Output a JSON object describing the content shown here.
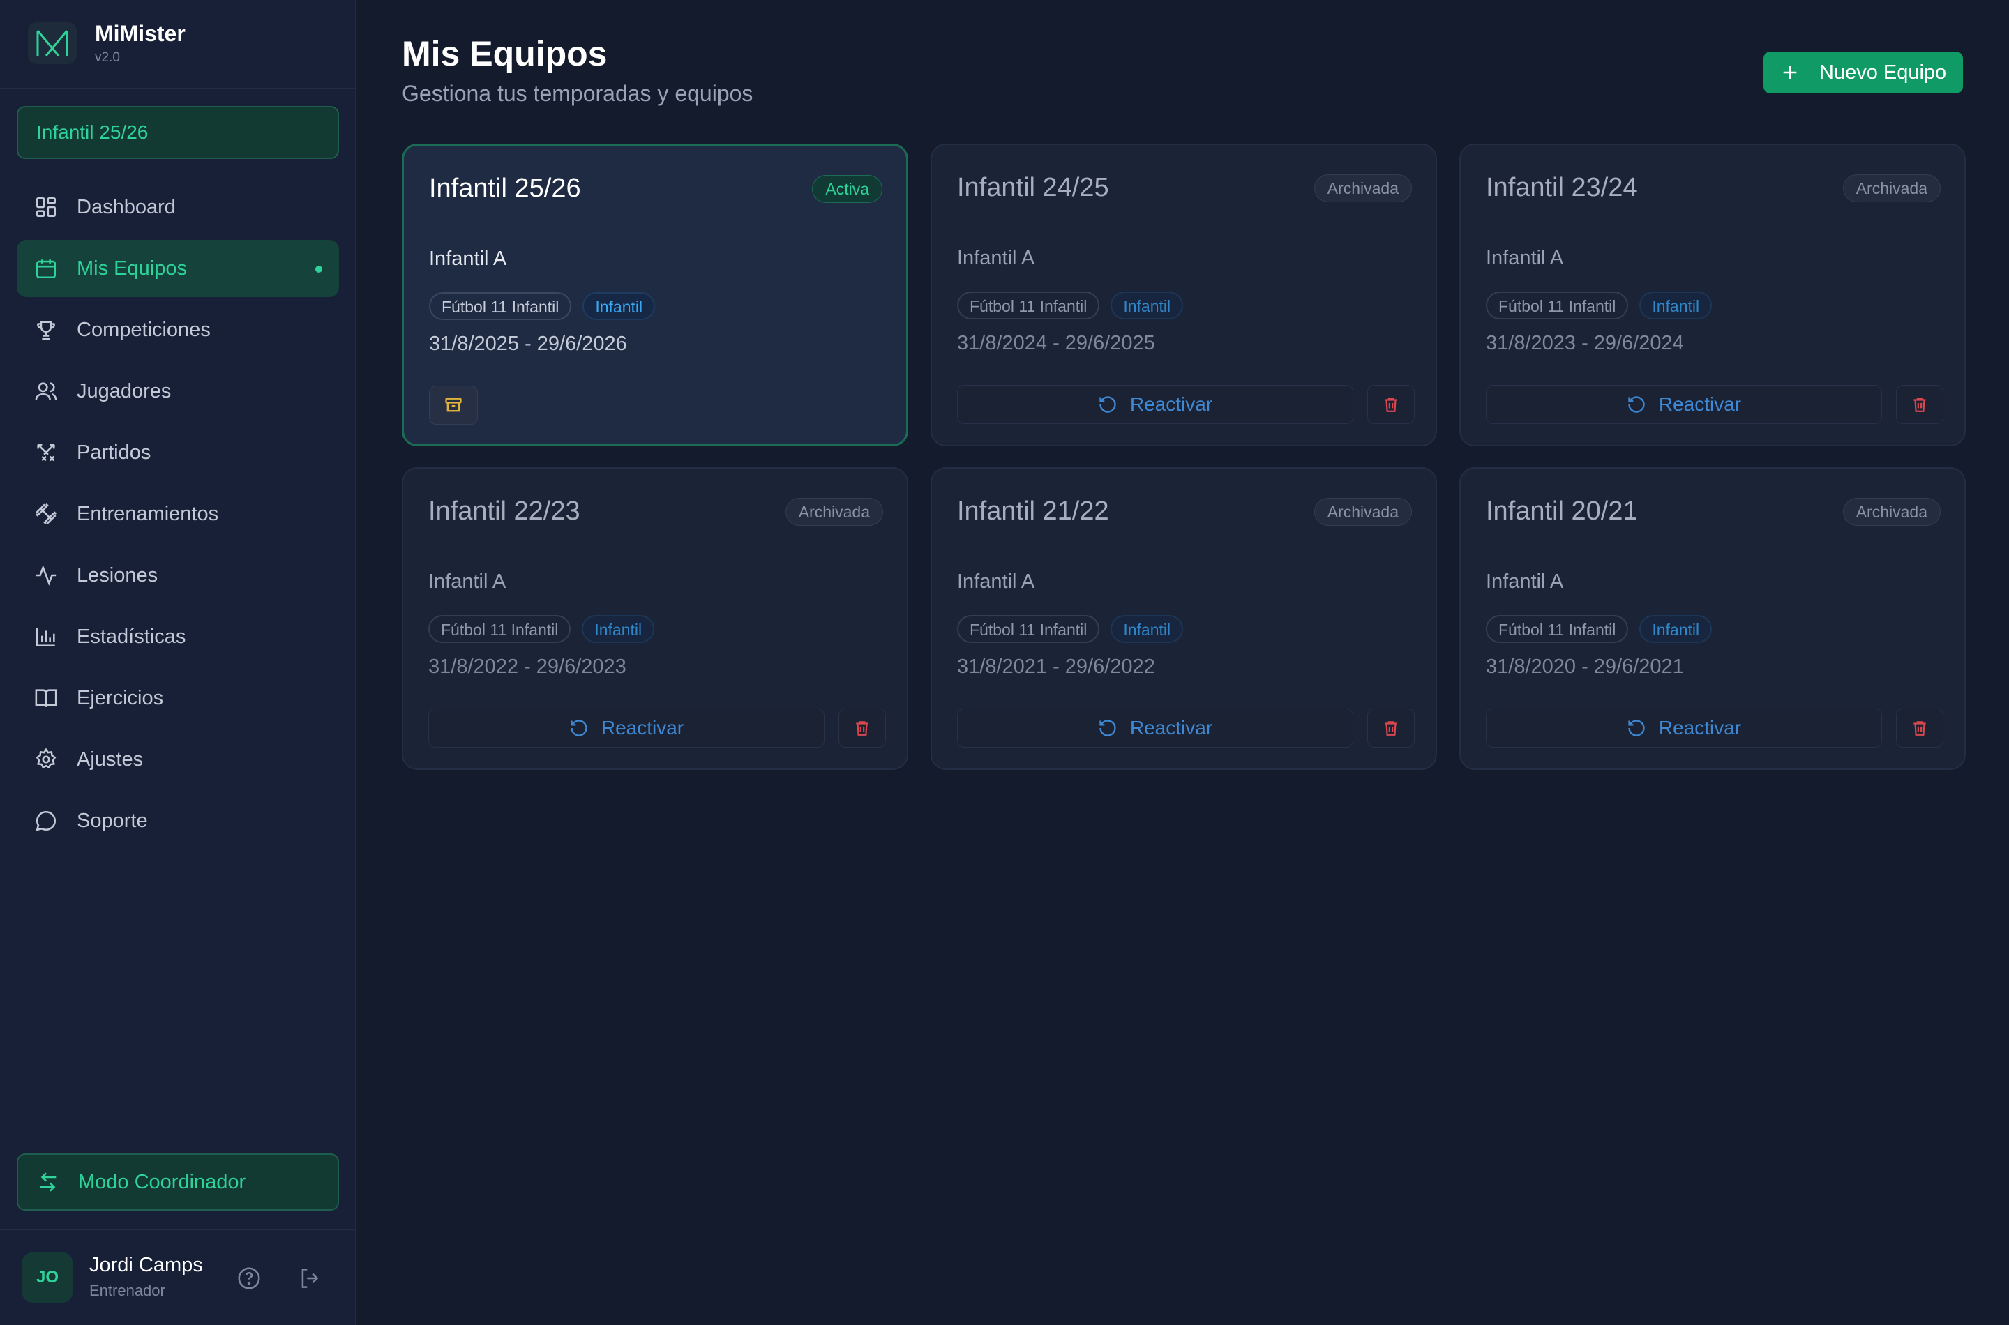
{
  "brand": {
    "name": "MiMister",
    "version": "v2.0"
  },
  "team_selector": {
    "value": "Infantil 25/26"
  },
  "sidebar": {
    "items": [
      {
        "label": "Dashboard",
        "icon": "dashboard-icon"
      },
      {
        "label": "Mis Equipos",
        "icon": "calendar-icon",
        "active": true
      },
      {
        "label": "Competiciones",
        "icon": "trophy-icon"
      },
      {
        "label": "Jugadores",
        "icon": "users-icon"
      },
      {
        "label": "Partidos",
        "icon": "swords-icon"
      },
      {
        "label": "Entrenamientos",
        "icon": "dumbbell-icon"
      },
      {
        "label": "Lesiones",
        "icon": "activity-icon"
      },
      {
        "label": "Estadísticas",
        "icon": "bar-chart-icon"
      },
      {
        "label": "Ejercicios",
        "icon": "book-icon"
      },
      {
        "label": "Ajustes",
        "icon": "gear-icon"
      },
      {
        "label": "Soporte",
        "icon": "message-icon"
      }
    ],
    "coordinator_label": "Modo Coordinador"
  },
  "user": {
    "initials": "JO",
    "name": "Jordi Camps",
    "role": "Entrenador"
  },
  "header": {
    "title": "Mis Equipos",
    "subtitle": "Gestiona tus temporadas y equipos",
    "new_button": "Nuevo Equipo"
  },
  "teams": [
    {
      "title": "Infantil 25/26",
      "status": "Activa",
      "team": "Infantil A",
      "mode": "Fútbol 11 Infantil",
      "category": "Infantil",
      "dates": "31/8/2025 - 29/6/2026"
    },
    {
      "title": "Infantil 24/25",
      "status": "Archivada",
      "team": "Infantil A",
      "mode": "Fútbol 11 Infantil",
      "category": "Infantil",
      "dates": "31/8/2024 - 29/6/2025",
      "action": "Reactivar"
    },
    {
      "title": "Infantil 23/24",
      "status": "Archivada",
      "team": "Infantil A",
      "mode": "Fútbol 11 Infantil",
      "category": "Infantil",
      "dates": "31/8/2023 - 29/6/2024",
      "action": "Reactivar"
    },
    {
      "title": "Infantil 22/23",
      "status": "Archivada",
      "team": "Infantil A",
      "mode": "Fútbol 11 Infantil",
      "category": "Infantil",
      "dates": "31/8/2022 - 29/6/2023",
      "action": "Reactivar"
    },
    {
      "title": "Infantil 21/22",
      "status": "Archivada",
      "team": "Infantil A",
      "mode": "Fútbol 11 Infantil",
      "category": "Infantil",
      "dates": "31/8/2021 - 29/6/2022",
      "action": "Reactivar"
    },
    {
      "title": "Infantil 20/21",
      "status": "Archivada",
      "team": "Infantil A",
      "mode": "Fútbol 11 Infantil",
      "category": "Infantil",
      "dates": "31/8/2020 - 29/6/2021",
      "action": "Reactivar"
    }
  ],
  "colors": {
    "accent": "#2ed39a",
    "primary_button": "#0f9a66",
    "background": "#141b2c",
    "sidebar": "#172036",
    "link": "#3f89d4",
    "danger": "#d9474f",
    "warning": "#e0b33a"
  }
}
